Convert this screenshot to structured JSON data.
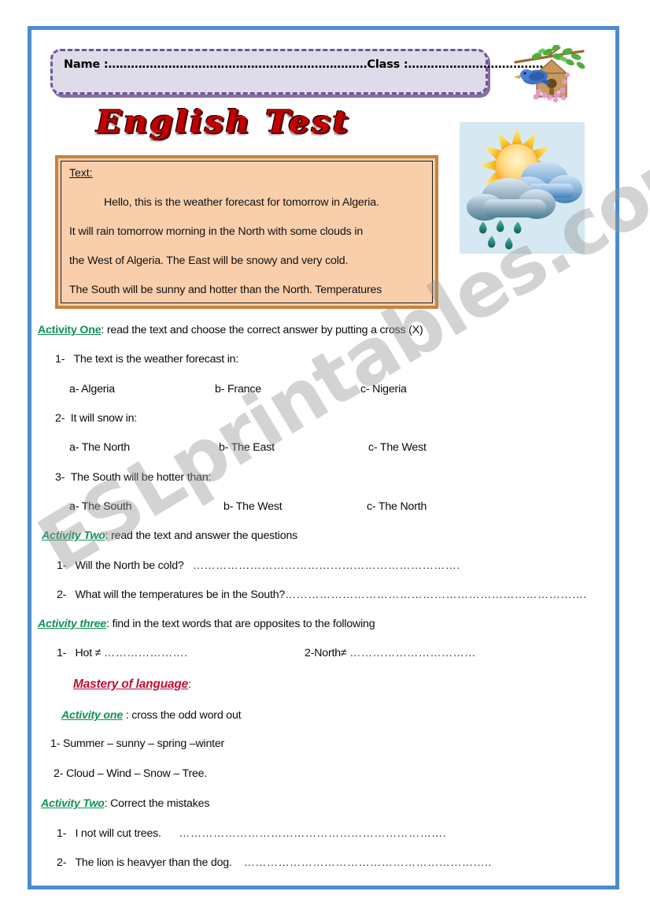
{
  "page": {
    "border_color": "#4e8ccc",
    "background": "#ffffff",
    "watermark": "ESLprintables.com"
  },
  "header": {
    "name_class_line": "Name :……………………………………………………………Class :……………………………….",
    "title": "English Test"
  },
  "clipart": {
    "birdhouse": "birdhouse-with-bluebird-and-blossoms",
    "weather": "sun-behind-rain-clouds"
  },
  "text_box": {
    "label": "Text:",
    "lines": [
      "Hello,  this is the weather forecast for tomorrow in Algeria.",
      "It will rain tomorrow morning in the North with some clouds in",
      "the West of Algeria. The East will be snowy and very cold.",
      "The South will be sunny and hotter than the North. Temperatures"
    ],
    "fill_color": "#f9cfab",
    "border_color": "#c9823a"
  },
  "activities": {
    "one": {
      "heading": "Activity One",
      "instruction": ": read the text and choose the correct answer by putting a cross (X)",
      "questions": [
        {
          "number": "1-",
          "prompt": "The text is the weather forecast in:",
          "choices": [
            "a-  Algeria",
            "b- France",
            "c- Nigeria"
          ]
        },
        {
          "number": "2-",
          "prompt": "It will snow in:",
          "choices": [
            "a-  The North",
            "b- The East",
            "c- The West"
          ]
        },
        {
          "number": "3-",
          "prompt": "The South will be hotter than:",
          "choices": [
            "a-  The South",
            "b- The West",
            "c- The North"
          ]
        }
      ]
    },
    "two": {
      "heading": "Activity Two",
      "instruction": ": read the text and answer the questions",
      "questions": [
        {
          "number": "1-",
          "prompt": "Will the North be cold?",
          "answer_dots": "……………………………………………………………."
        },
        {
          "number": "2-",
          "prompt": "What will the temperatures be in the South?",
          "answer_dots": "……………………………………………………………………."
        }
      ]
    },
    "three": {
      "heading": "Activity three",
      "instruction": ": find in the text words that are opposites to the following",
      "items": [
        {
          "number": "1-",
          "prompt": "Hot ≠",
          "answer_dots": "…………………."
        },
        {
          "number": "",
          "prompt": "2-North≠",
          "answer_dots": "……………………………"
        }
      ]
    }
  },
  "mastery": {
    "heading": "Mastery of language",
    "colon": ":",
    "activity_one": {
      "heading": "Activity one",
      "instruction": " : cross the odd word out",
      "items": [
        "1- Summer – sunny – spring –winter",
        "2- Cloud – Wind – Snow – Tree."
      ]
    },
    "activity_two": {
      "heading": "Activity Two",
      "instruction": ": Correct the mistakes",
      "items": [
        {
          "number": "1-",
          "prompt": "I not will cut trees.",
          "answer_dots": "……………………………………………………………."
        },
        {
          "number": "2-",
          "prompt": "The lion is heavyer than the dog.",
          "answer_dots": "……………………………………………………….."
        }
      ]
    }
  }
}
